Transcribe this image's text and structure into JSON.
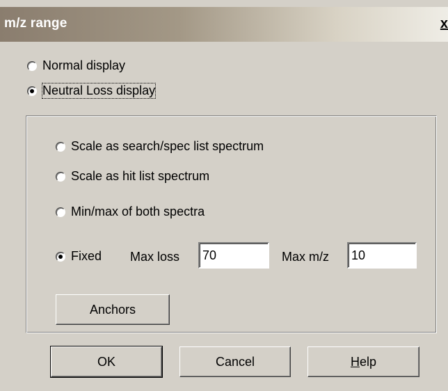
{
  "window": {
    "title": "m/z range",
    "close_label": "x"
  },
  "display_mode": {
    "options": [
      {
        "label": "Normal display",
        "checked": false
      },
      {
        "label": "Neutral Loss display",
        "checked": true
      }
    ]
  },
  "scale": {
    "options": [
      {
        "label": "Scale as search/spec list spectrum",
        "checked": false
      },
      {
        "label": "Scale as hit list spectrum",
        "checked": false
      },
      {
        "label": "Min/max of both spectra",
        "checked": false
      },
      {
        "label": "Fixed",
        "checked": true
      }
    ],
    "max_loss_label": "Max loss",
    "max_loss_value": "70",
    "max_mz_label": "Max m/z",
    "max_mz_value": "10",
    "anchors_label": "Anchors"
  },
  "buttons": {
    "ok_label": "OK",
    "cancel_label": "Cancel",
    "help_label": "Help"
  }
}
